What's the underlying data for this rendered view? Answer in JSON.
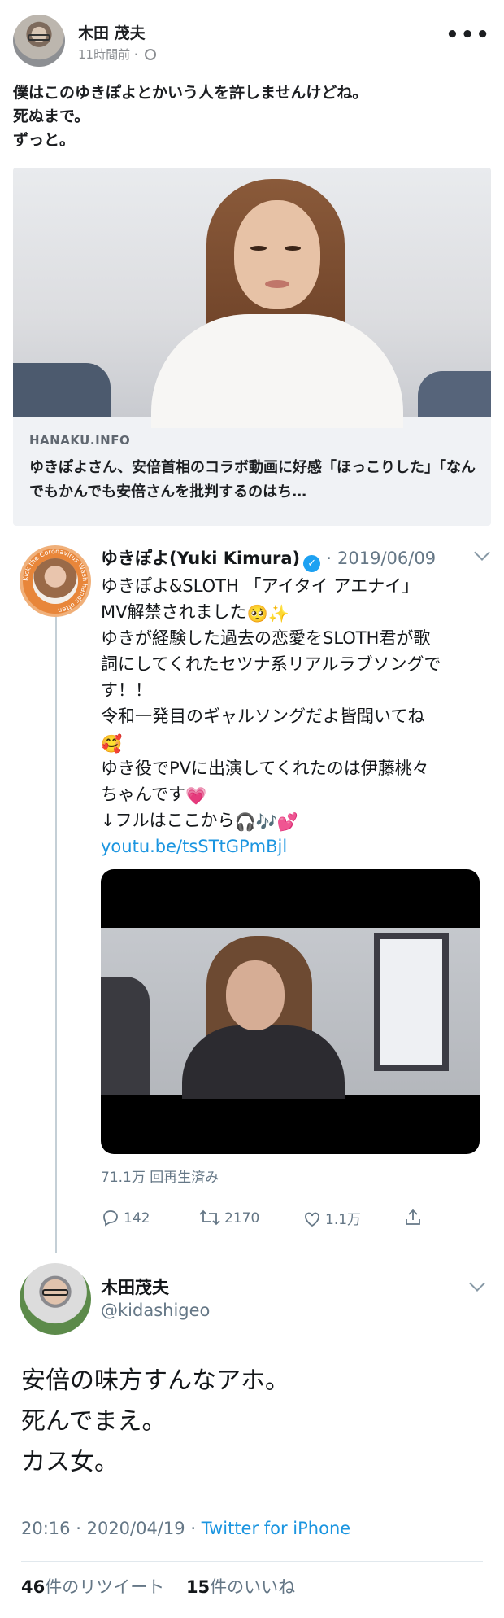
{
  "facebook_post": {
    "author": "木田 茂夫",
    "time": "11時間前",
    "separator": "·",
    "body_lines": [
      "僕はこのゆきぽよとかいう人を許しませんけどね。",
      "死ぬまで。",
      "ずっと。"
    ],
    "link": {
      "domain": "HANAKU.INFO",
      "title": "ゆきぽよさん、安倍首相のコラボ動画に好感「ほっこりした」「なんでもかんでも安倍さんを批判するのはち…"
    }
  },
  "embedded_tweet": {
    "name": "ゆきぽよ(Yuki Kimura)",
    "date": "2019/06/09",
    "date_sep": "·",
    "lines": [
      "ゆきぽよ&SLOTH 「アイタイ アエナイ」",
      "MV解禁されました",
      "ゆきが経験した過去の恋愛をSLOTH君が歌",
      "詞にしてくれたセツナ系リアルラブソングで",
      "す！！",
      "令和一発目のギャルソングだよ皆聞いてね",
      "",
      "ゆき役でPVに出演してくれたのは伊藤桃々",
      "ちゃんです",
      "↓フルはここから"
    ],
    "emojis": {
      "line2": [
        "🥺",
        "✨"
      ],
      "line7": [
        "🥰"
      ],
      "line9": [
        "💗"
      ],
      "line10": [
        "🎧",
        "🎶",
        "💕"
      ]
    },
    "link": "youtu.be/tsSTtGPmBjl",
    "avatar_ring_text": "Kick the Coronavirus Wash hands often",
    "views": "71.1万 回再生済み",
    "actions": {
      "reply_count": "142",
      "retweet_count": "2170",
      "like_count": "1.1万"
    }
  },
  "reply_tweet": {
    "name": "木田茂夫",
    "handle": "@kidashigeo",
    "text_lines": [
      "安倍の味方すんなアホ。",
      "死んでまえ。",
      "カス女。"
    ],
    "time": "20:16",
    "date": "2020/04/19",
    "sep": "·",
    "app": "Twitter for iPhone",
    "retweets_count": "46",
    "retweets_label": "件のリツイート",
    "likes_count": "15",
    "likes_label": "件のいいね"
  },
  "colors": {
    "twitter_blue": "#1da1f2",
    "link_blue": "#1b95e0",
    "secondary_text": "#657786",
    "card_bg": "#f0f2f5"
  }
}
